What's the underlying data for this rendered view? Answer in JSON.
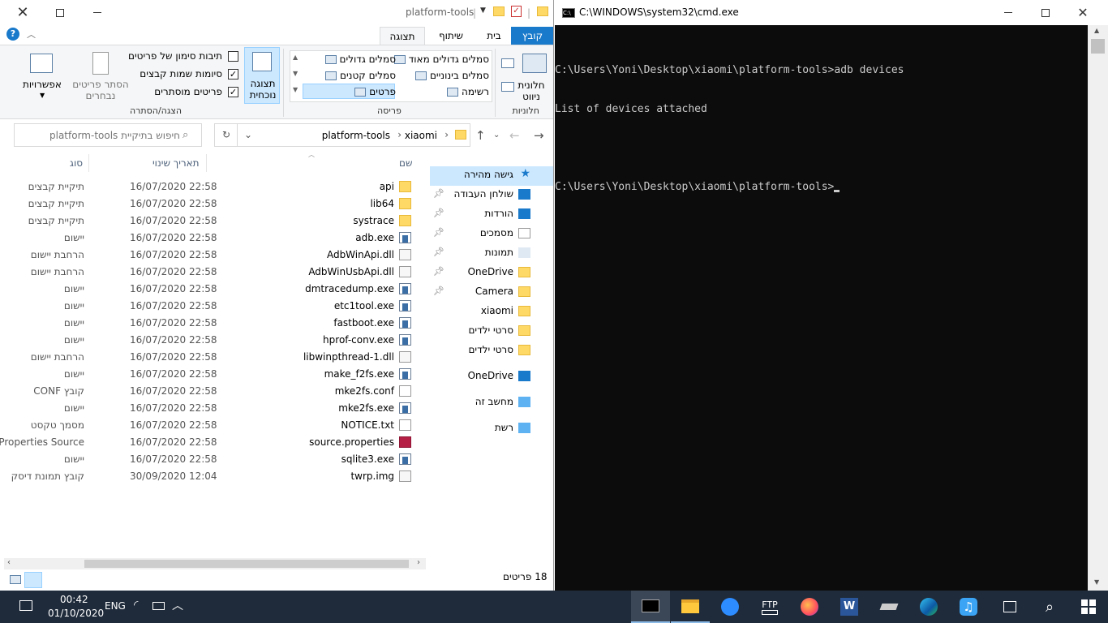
{
  "explorer": {
    "title": "platform-tools",
    "tabs": [
      "קובץ",
      "בית",
      "שיתוף",
      "תצוגה"
    ],
    "ribbon": {
      "panes": {
        "nav_pane": "חלונית ניווט",
        "group": "חלוניות"
      },
      "layout": {
        "items": [
          "סמלים גדולים מאוד",
          "סמלים גדולים",
          "סמלים בינוניים",
          "סמלים קטנים",
          "רשימה",
          "פרטים"
        ],
        "group": "פריסה"
      },
      "current_view": "תצוגה נוכחית",
      "showhide": {
        "checkboxes": [
          "תיבות סימון של פריטים",
          "סיומות שמות קבצים",
          "פריטים מוסתרים"
        ],
        "hide_selected": "הסתר פריטים נבחרים",
        "options": "אפשרויות",
        "group": "הצגה/הסתרה"
      }
    },
    "address": {
      "crumbs": [
        "xiaomi",
        "platform-tools"
      ]
    },
    "search_placeholder": "חיפוש בתיקיית platform-tools",
    "columns": {
      "name": "שם",
      "date": "תאריך שינוי",
      "type": "סוג"
    },
    "files": [
      {
        "name": "api",
        "date": "16/07/2020 22:58",
        "type": "תיקיית קבצים",
        "icon": "folder"
      },
      {
        "name": "lib64",
        "date": "16/07/2020 22:58",
        "type": "תיקיית קבצים",
        "icon": "folder"
      },
      {
        "name": "systrace",
        "date": "16/07/2020 22:58",
        "type": "תיקיית קבצים",
        "icon": "folder"
      },
      {
        "name": "adb.exe",
        "date": "16/07/2020 22:58",
        "type": "יישום",
        "icon": "exe"
      },
      {
        "name": "AdbWinApi.dll",
        "date": "16/07/2020 22:58",
        "type": "הרחבת יישום",
        "icon": "dll"
      },
      {
        "name": "AdbWinUsbApi.dll",
        "date": "16/07/2020 22:58",
        "type": "הרחבת יישום",
        "icon": "dll"
      },
      {
        "name": "dmtracedump.exe",
        "date": "16/07/2020 22:58",
        "type": "יישום",
        "icon": "exe"
      },
      {
        "name": "etc1tool.exe",
        "date": "16/07/2020 22:58",
        "type": "יישום",
        "icon": "exe"
      },
      {
        "name": "fastboot.exe",
        "date": "16/07/2020 22:58",
        "type": "יישום",
        "icon": "exe"
      },
      {
        "name": "hprof-conv.exe",
        "date": "16/07/2020 22:58",
        "type": "יישום",
        "icon": "exe"
      },
      {
        "name": "libwinpthread-1.dll",
        "date": "16/07/2020 22:58",
        "type": "הרחבת יישום",
        "icon": "dll"
      },
      {
        "name": "make_f2fs.exe",
        "date": "16/07/2020 22:58",
        "type": "יישום",
        "icon": "exe"
      },
      {
        "name": "mke2fs.conf",
        "date": "16/07/2020 22:58",
        "type": "קובץ CONF",
        "icon": "doc"
      },
      {
        "name": "mke2fs.exe",
        "date": "16/07/2020 22:58",
        "type": "יישום",
        "icon": "exe"
      },
      {
        "name": "NOTICE.txt",
        "date": "16/07/2020 22:58",
        "type": "מסמך טקסט",
        "icon": "doc"
      },
      {
        "name": "source.properties",
        "date": "16/07/2020 22:58",
        "type": "Properties Source ...",
        "icon": "prop"
      },
      {
        "name": "sqlite3.exe",
        "date": "16/07/2020 22:58",
        "type": "יישום",
        "icon": "exe"
      },
      {
        "name": "twrp.img",
        "date": "30/09/2020 12:04",
        "type": "קובץ תמונת דיסק",
        "icon": "dll"
      }
    ],
    "nav": [
      {
        "label": "גישה מהירה",
        "icon": "star",
        "pin": false
      },
      {
        "label": "שולחן העבודה",
        "icon": "desktop",
        "pin": true
      },
      {
        "label": "הורדות",
        "icon": "download",
        "pin": true
      },
      {
        "label": "מסמכים",
        "icon": "doc",
        "pin": true
      },
      {
        "label": "תמונות",
        "icon": "pictures",
        "pin": true
      },
      {
        "label": "OneDrive",
        "icon": "folder",
        "pin": true
      },
      {
        "label": "Camera",
        "icon": "folder",
        "pin": true
      },
      {
        "label": "xiaomi",
        "icon": "folder",
        "pin": false
      },
      {
        "label": "סרטי ילדים",
        "icon": "folder",
        "pin": false
      },
      {
        "label": "סרטי ילדים",
        "icon": "folder",
        "pin": false
      },
      {
        "label": "OneDrive",
        "icon": "cloud",
        "pin": false
      },
      {
        "label": "מחשב זה",
        "icon": "pc",
        "pin": false
      },
      {
        "label": "רשת",
        "icon": "network",
        "pin": false
      }
    ],
    "status": "18 פריטים"
  },
  "cmd": {
    "title": "C:\\WINDOWS\\system32\\cmd.exe",
    "lines": [
      "C:\\Users\\Yoni\\Desktop\\xiaomi\\platform-tools>adb devices",
      "List of devices attached",
      "",
      "C:\\Users\\Yoni\\Desktop\\xiaomi\\platform-tools>"
    ]
  },
  "taskbar": {
    "time": "00:42",
    "date": "01/10/2020",
    "lang": "ENG",
    "ftp_label": "FTP"
  },
  "colors": {
    "accent": "#1979ca",
    "selected": "#cce8ff",
    "taskbar": "#1f2b3b"
  }
}
